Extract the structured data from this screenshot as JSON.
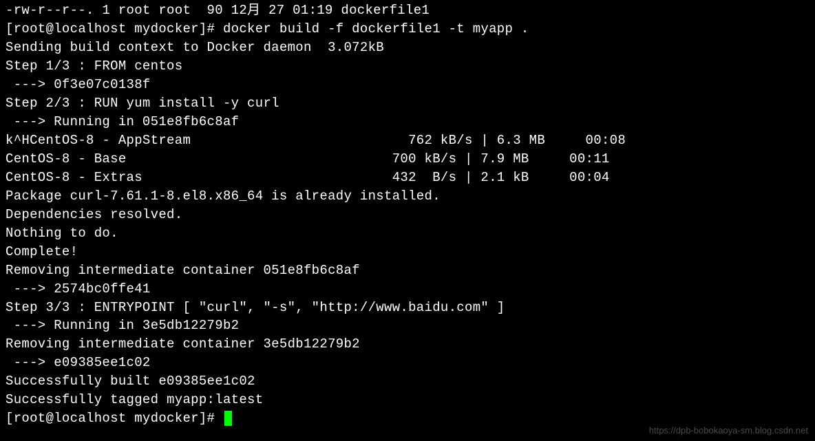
{
  "terminal": {
    "lines": {
      "l0": "-rw-r--r--. 1 root root  90 12月 27 01:19 dockerfile1",
      "l1": "[root@localhost mydocker]# docker build -f dockerfile1 -t myapp .",
      "l2": "Sending build context to Docker daemon  3.072kB",
      "l3": "Step 1/3 : FROM centos",
      "l4": " ---> 0f3e07c0138f",
      "l5": "Step 2/3 : RUN yum install -y curl",
      "l6": " ---> Running in 051e8fb6c8af",
      "l7": "k^HCentOS-8 - AppStream                           762 kB/s | 6.3 MB     00:08",
      "l8": "CentOS-8 - Base                                 700 kB/s | 7.9 MB     00:11",
      "l9": "CentOS-8 - Extras                               432  B/s | 2.1 kB     00:04",
      "l10": "Package curl-7.61.1-8.el8.x86_64 is already installed.",
      "l11": "Dependencies resolved.",
      "l12": "Nothing to do.",
      "l13": "Complete!",
      "l14": "Removing intermediate container 051e8fb6c8af",
      "l15": " ---> 2574bc0ffe41",
      "l16": "Step 3/3 : ENTRYPOINT [ \"curl\", \"-s\", \"http://www.baidu.com\" ]",
      "l17": " ---> Running in 3e5db12279b2",
      "l18": "Removing intermediate container 3e5db12279b2",
      "l19": " ---> e09385ee1c02",
      "l20": "Successfully built e09385ee1c02",
      "l21": "Successfully tagged myapp:latest",
      "l22": "[root@localhost mydocker]# "
    }
  },
  "watermark": "https://dpb-bobokaoya-sm.blog.csdn.net"
}
